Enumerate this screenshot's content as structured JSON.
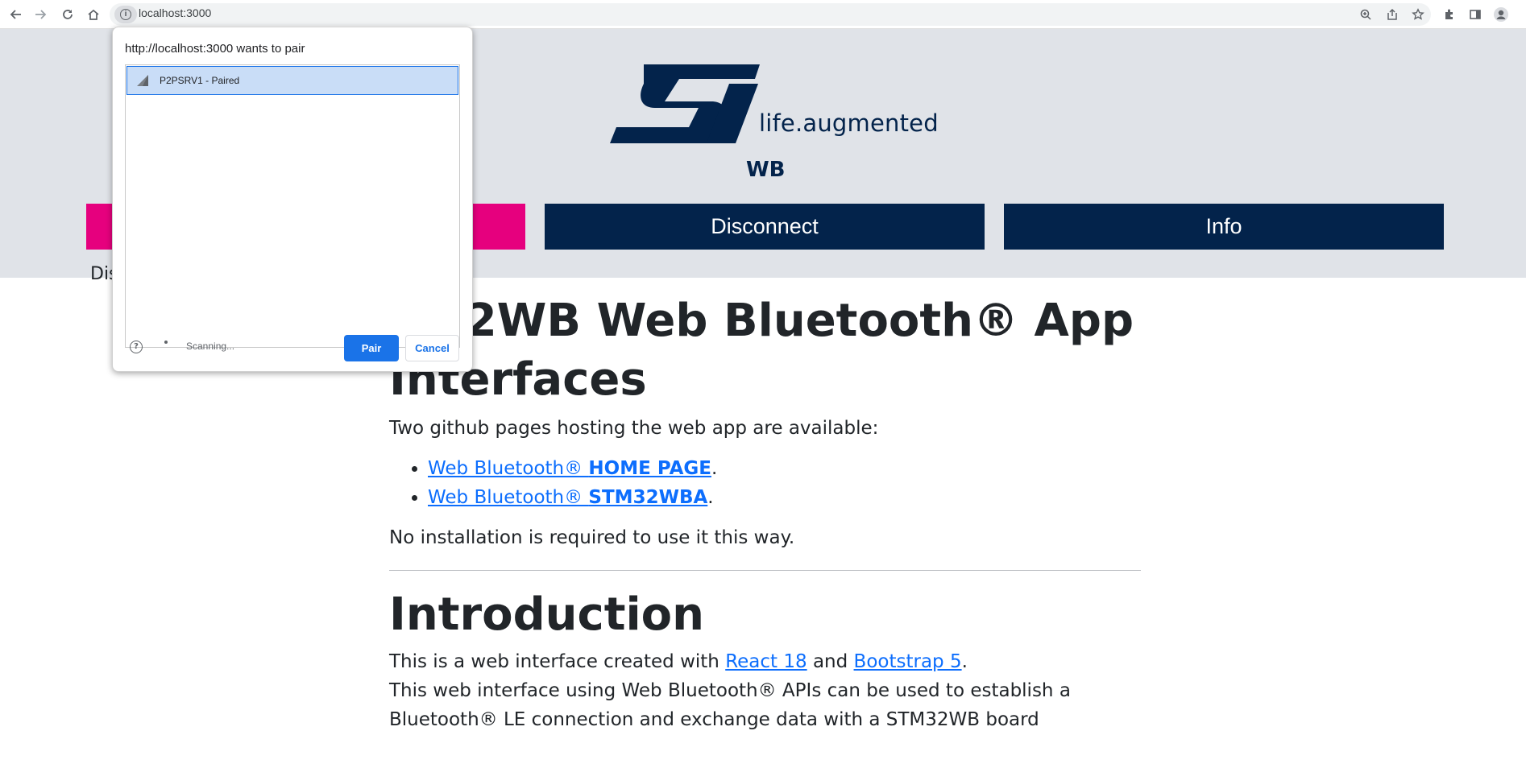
{
  "browser": {
    "url": "localhost:3000",
    "icons": [
      "back-icon",
      "forward-icon",
      "reload-icon",
      "home-icon",
      "info-icon",
      "zoom-icon",
      "share-icon",
      "star-icon",
      "extensions-icon",
      "sidepanel-icon",
      "profile-icon"
    ]
  },
  "header": {
    "logo_tagline": "life.augmented",
    "subtitle": "WB",
    "buttons": {
      "connect": "",
      "disconnect": "Disconnect",
      "info": "Info"
    },
    "status_text": "Dis"
  },
  "main": {
    "title_line1": "M32WB Web Bluetooth® App",
    "title_line2": "Interfaces",
    "intro_text": "Two github pages hosting the web app are available:",
    "links": [
      {
        "prefix": "Web Bluetooth® ",
        "bold": "HOME PAGE",
        "suffix": "."
      },
      {
        "prefix": "Web Bluetooth® ",
        "bold": "STM32WBA",
        "suffix": "."
      }
    ],
    "no_install": "No installation is required to use it this way.",
    "intro_heading": "Introduction",
    "intro_p1_start": "This is a web interface created with ",
    "react_link": "React 18",
    "and": " and ",
    "bootstrap_link": "Bootstrap 5",
    "period": ".",
    "intro_p2": "This web interface using Web Bluetooth® APIs can be used to establish a Bluetooth® LE connection and exchange data with a STM32WB board"
  },
  "popup": {
    "title": "http://localhost:3000 wants to pair",
    "device": "P2PSRV1 - Paired",
    "status": "Scanning...",
    "pair": "Pair",
    "cancel": "Cancel"
  },
  "colors": {
    "st_blue": "#03234b",
    "st_pink": "#e6007e",
    "link_blue": "#0d6efd",
    "chrome_blue": "#1a73e8"
  }
}
